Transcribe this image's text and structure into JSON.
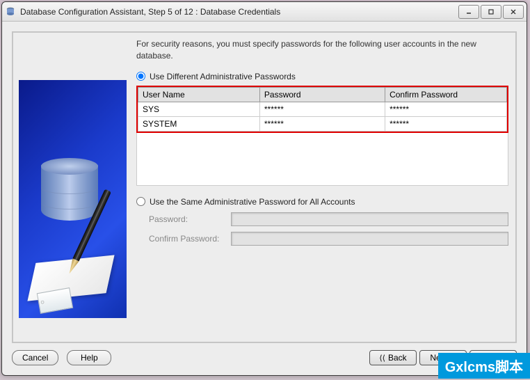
{
  "title": "Database Configuration Assistant, Step 5 of 12 : Database Credentials",
  "intro": "For security reasons, you must specify passwords for the following user accounts in the new database.",
  "options": {
    "different": "Use Different Administrative Passwords",
    "same": "Use the Same Administrative Password for All Accounts"
  },
  "table": {
    "headers": {
      "user": "User Name",
      "password": "Password",
      "confirm": "Confirm Password"
    },
    "rows": [
      {
        "user": "SYS",
        "password": "******",
        "confirm": "******"
      },
      {
        "user": "SYSTEM",
        "password": "******",
        "confirm": "******"
      }
    ]
  },
  "fields": {
    "password": "Password:",
    "confirm": "Confirm Password:"
  },
  "buttons": {
    "cancel": "Cancel",
    "help": "Help",
    "back": "Back",
    "next": "Next",
    "finish": "Finish"
  },
  "watermark": "Gxlcms脚本"
}
